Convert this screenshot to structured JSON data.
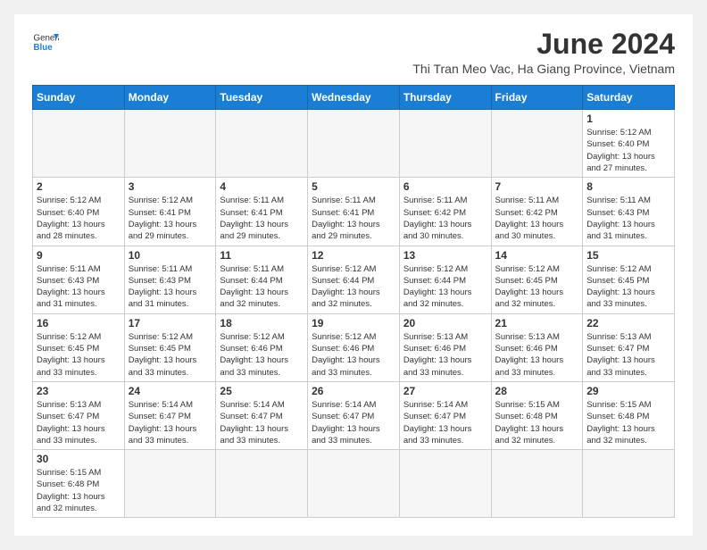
{
  "header": {
    "logo_general": "General",
    "logo_blue": "Blue",
    "month_year": "June 2024",
    "location": "Thi Tran Meo Vac, Ha Giang Province, Vietnam"
  },
  "days_of_week": [
    "Sunday",
    "Monday",
    "Tuesday",
    "Wednesday",
    "Thursday",
    "Friday",
    "Saturday"
  ],
  "weeks": [
    [
      {
        "date": "",
        "info": ""
      },
      {
        "date": "",
        "info": ""
      },
      {
        "date": "",
        "info": ""
      },
      {
        "date": "",
        "info": ""
      },
      {
        "date": "",
        "info": ""
      },
      {
        "date": "",
        "info": ""
      },
      {
        "date": "1",
        "info": "Sunrise: 5:12 AM\nSunset: 6:40 PM\nDaylight: 13 hours and 27 minutes."
      }
    ],
    [
      {
        "date": "2",
        "info": "Sunrise: 5:12 AM\nSunset: 6:40 PM\nDaylight: 13 hours and 28 minutes."
      },
      {
        "date": "3",
        "info": "Sunrise: 5:12 AM\nSunset: 6:41 PM\nDaylight: 13 hours and 29 minutes."
      },
      {
        "date": "4",
        "info": "Sunrise: 5:11 AM\nSunset: 6:41 PM\nDaylight: 13 hours and 29 minutes."
      },
      {
        "date": "5",
        "info": "Sunrise: 5:11 AM\nSunset: 6:41 PM\nDaylight: 13 hours and 29 minutes."
      },
      {
        "date": "6",
        "info": "Sunrise: 5:11 AM\nSunset: 6:42 PM\nDaylight: 13 hours and 30 minutes."
      },
      {
        "date": "7",
        "info": "Sunrise: 5:11 AM\nSunset: 6:42 PM\nDaylight: 13 hours and 30 minutes."
      },
      {
        "date": "8",
        "info": "Sunrise: 5:11 AM\nSunset: 6:43 PM\nDaylight: 13 hours and 31 minutes."
      }
    ],
    [
      {
        "date": "9",
        "info": "Sunrise: 5:11 AM\nSunset: 6:43 PM\nDaylight: 13 hours and 31 minutes."
      },
      {
        "date": "10",
        "info": "Sunrise: 5:11 AM\nSunset: 6:43 PM\nDaylight: 13 hours and 31 minutes."
      },
      {
        "date": "11",
        "info": "Sunrise: 5:11 AM\nSunset: 6:44 PM\nDaylight: 13 hours and 32 minutes."
      },
      {
        "date": "12",
        "info": "Sunrise: 5:12 AM\nSunset: 6:44 PM\nDaylight: 13 hours and 32 minutes."
      },
      {
        "date": "13",
        "info": "Sunrise: 5:12 AM\nSunset: 6:44 PM\nDaylight: 13 hours and 32 minutes."
      },
      {
        "date": "14",
        "info": "Sunrise: 5:12 AM\nSunset: 6:45 PM\nDaylight: 13 hours and 32 minutes."
      },
      {
        "date": "15",
        "info": "Sunrise: 5:12 AM\nSunset: 6:45 PM\nDaylight: 13 hours and 33 minutes."
      }
    ],
    [
      {
        "date": "16",
        "info": "Sunrise: 5:12 AM\nSunset: 6:45 PM\nDaylight: 13 hours and 33 minutes."
      },
      {
        "date": "17",
        "info": "Sunrise: 5:12 AM\nSunset: 6:45 PM\nDaylight: 13 hours and 33 minutes."
      },
      {
        "date": "18",
        "info": "Sunrise: 5:12 AM\nSunset: 6:46 PM\nDaylight: 13 hours and 33 minutes."
      },
      {
        "date": "19",
        "info": "Sunrise: 5:12 AM\nSunset: 6:46 PM\nDaylight: 13 hours and 33 minutes."
      },
      {
        "date": "20",
        "info": "Sunrise: 5:13 AM\nSunset: 6:46 PM\nDaylight: 13 hours and 33 minutes."
      },
      {
        "date": "21",
        "info": "Sunrise: 5:13 AM\nSunset: 6:46 PM\nDaylight: 13 hours and 33 minutes."
      },
      {
        "date": "22",
        "info": "Sunrise: 5:13 AM\nSunset: 6:47 PM\nDaylight: 13 hours and 33 minutes."
      }
    ],
    [
      {
        "date": "23",
        "info": "Sunrise: 5:13 AM\nSunset: 6:47 PM\nDaylight: 13 hours and 33 minutes."
      },
      {
        "date": "24",
        "info": "Sunrise: 5:14 AM\nSunset: 6:47 PM\nDaylight: 13 hours and 33 minutes."
      },
      {
        "date": "25",
        "info": "Sunrise: 5:14 AM\nSunset: 6:47 PM\nDaylight: 13 hours and 33 minutes."
      },
      {
        "date": "26",
        "info": "Sunrise: 5:14 AM\nSunset: 6:47 PM\nDaylight: 13 hours and 33 minutes."
      },
      {
        "date": "27",
        "info": "Sunrise: 5:14 AM\nSunset: 6:47 PM\nDaylight: 13 hours and 33 minutes."
      },
      {
        "date": "28",
        "info": "Sunrise: 5:15 AM\nSunset: 6:48 PM\nDaylight: 13 hours and 32 minutes."
      },
      {
        "date": "29",
        "info": "Sunrise: 5:15 AM\nSunset: 6:48 PM\nDaylight: 13 hours and 32 minutes."
      }
    ],
    [
      {
        "date": "30",
        "info": "Sunrise: 5:15 AM\nSunset: 6:48 PM\nDaylight: 13 hours and 32 minutes."
      },
      {
        "date": "",
        "info": ""
      },
      {
        "date": "",
        "info": ""
      },
      {
        "date": "",
        "info": ""
      },
      {
        "date": "",
        "info": ""
      },
      {
        "date": "",
        "info": ""
      },
      {
        "date": "",
        "info": ""
      }
    ]
  ]
}
